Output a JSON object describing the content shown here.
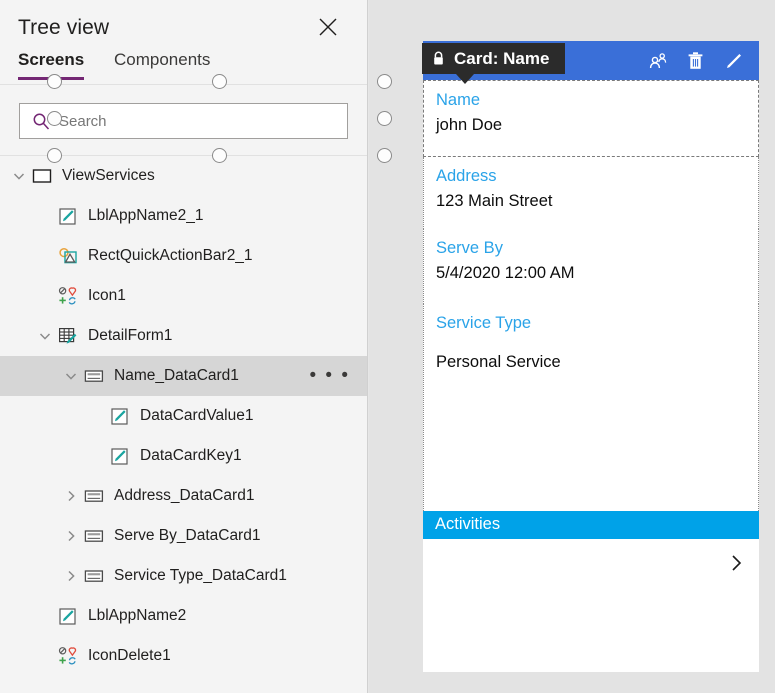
{
  "panel": {
    "title": "Tree view",
    "close_icon": "close-icon",
    "tabs": [
      {
        "label": "Screens",
        "active": true
      },
      {
        "label": "Components",
        "active": false
      }
    ],
    "search": {
      "placeholder": "Search",
      "value": "",
      "icon": "search-icon"
    },
    "accent_color": "#742774"
  },
  "tree": [
    {
      "label": "ViewServices",
      "indent": 0,
      "chevron": "down",
      "icon": "screen-icon",
      "selected": false,
      "ellipsis": false
    },
    {
      "label": "LblAppName2_1",
      "indent": 1,
      "chevron": "none",
      "icon": "label-icon",
      "selected": false,
      "ellipsis": false
    },
    {
      "label": "RectQuickActionBar2_1",
      "indent": 1,
      "chevron": "none",
      "icon": "shapes-icon",
      "selected": false,
      "ellipsis": false
    },
    {
      "label": "Icon1",
      "indent": 1,
      "chevron": "none",
      "icon": "icons-grid-icon",
      "selected": false,
      "ellipsis": false
    },
    {
      "label": "DetailForm1",
      "indent": 1,
      "chevron": "down",
      "icon": "form-icon",
      "selected": false,
      "ellipsis": false
    },
    {
      "label": "Name_DataCard1",
      "indent": 2,
      "chevron": "down",
      "icon": "datacard-icon",
      "selected": true,
      "ellipsis": true
    },
    {
      "label": "DataCardValue1",
      "indent": 3,
      "chevron": "none",
      "icon": "label-icon",
      "selected": false,
      "ellipsis": false
    },
    {
      "label": "DataCardKey1",
      "indent": 3,
      "chevron": "none",
      "icon": "label-icon",
      "selected": false,
      "ellipsis": false
    },
    {
      "label": "Address_DataCard1",
      "indent": 2,
      "chevron": "right",
      "icon": "datacard-icon",
      "selected": false,
      "ellipsis": false
    },
    {
      "label": "Serve By_DataCard1",
      "indent": 2,
      "chevron": "right",
      "icon": "datacard-icon",
      "selected": false,
      "ellipsis": false
    },
    {
      "label": "Service Type_DataCard1",
      "indent": 2,
      "chevron": "right",
      "icon": "datacard-icon",
      "selected": false,
      "ellipsis": false
    },
    {
      "label": "LblAppName2",
      "indent": 1,
      "chevron": "none",
      "icon": "label-icon",
      "selected": false,
      "ellipsis": false
    },
    {
      "label": "IconDelete1",
      "indent": 1,
      "chevron": "none",
      "icon": "icons-grid-icon",
      "selected": false,
      "ellipsis": false
    }
  ],
  "canvas": {
    "tooltip": {
      "text": "Card: Name",
      "lock_icon": "lock-icon"
    },
    "toolbar": {
      "background": "#3a6fd8",
      "icons": [
        {
          "name": "share-people-icon"
        },
        {
          "name": "trash-icon"
        },
        {
          "name": "pencil-edit-icon"
        }
      ]
    },
    "card_fields": [
      {
        "key": "Name",
        "value": "john Doe",
        "selected": true
      },
      {
        "key": "Address",
        "value": "123 Main Street",
        "selected": false
      },
      {
        "key": "Serve By",
        "value": "5/4/2020 12:00 AM",
        "selected": false
      },
      {
        "key": "Service Type",
        "value": "Personal Service",
        "selected": false
      }
    ],
    "gallery": {
      "header": "Activities",
      "header_color": "#00a2e8",
      "chevron_icon": "chevron-right-icon"
    },
    "key_color": "#2aa3e8"
  }
}
